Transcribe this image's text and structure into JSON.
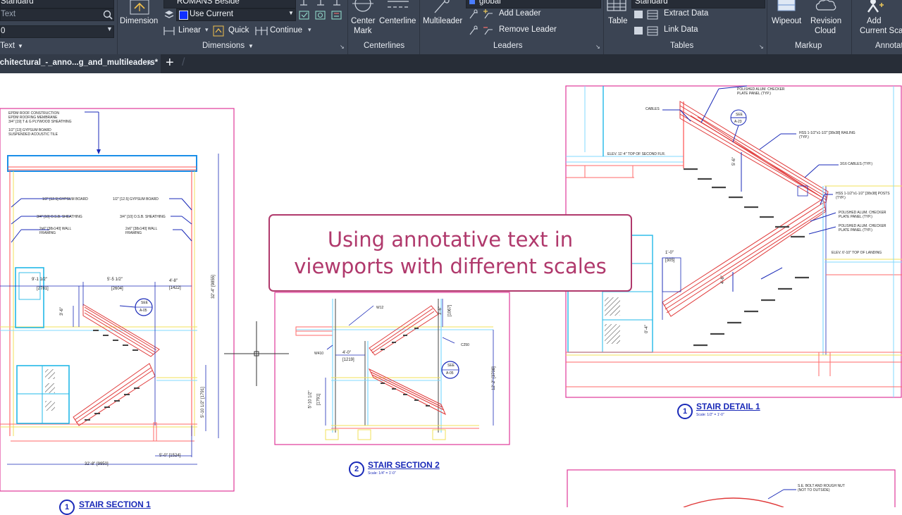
{
  "ribbon": {
    "text_panel": {
      "style_value": "Standard",
      "search_placeholder": "Text",
      "height_value": "0",
      "title": "Text"
    },
    "dimensions": {
      "dimension_label": "Dimension",
      "style_value": "ROMANS Beside",
      "layer_value": "Use Current",
      "linear_label": "Linear",
      "quick_label": "Quick",
      "continue_label": "Continue",
      "title": "Dimensions"
    },
    "centerlines": {
      "center_mark_label_1": "Center",
      "center_mark_label_2": "Mark",
      "centerline_label": "Centerline",
      "title": "Centerlines"
    },
    "leaders": {
      "multileader_label": "Multileader",
      "style_value": "global",
      "add_leader_label": "Add Leader",
      "remove_leader_label": "Remove Leader",
      "title": "Leaders"
    },
    "tables": {
      "table_label": "Table",
      "style_value": "Standard",
      "extract_data_label": "Extract Data",
      "link_data_label": "Link Data",
      "title": "Tables"
    },
    "markup": {
      "wipeout_label": "Wipeout",
      "revision_label_1": "Revision",
      "revision_label_2": "Cloud",
      "title": "Markup"
    },
    "annotation_scaling": {
      "add_label_1": "Add",
      "add_label_2": "Current Scale",
      "title": "Annotation Scaling"
    }
  },
  "document_tab": {
    "filename": "Architectural_-_anno...g_and_multileaders*",
    "close_symbol": "×",
    "new_tab_symbol": "+"
  },
  "callout": {
    "line1": "Using annotative text in",
    "line2": "viewports with different scales"
  },
  "viewports": [
    {
      "number": "1",
      "title": "STAIR SECTION 1",
      "scale": ""
    },
    {
      "number": "2",
      "title": "STAIR SECTION 2",
      "scale": "Scale: 1/4\" = 1'-0\""
    },
    {
      "number": "1",
      "title": "STAIR DETAIL 1",
      "scale": "Scale: 1/2\" = 1'-0\""
    }
  ],
  "drawing_notes": {
    "section1": {
      "roof_1": "EPDM ROOF CONSTRUCTION",
      "roof_2": "EPDM ROOFING MEMBRANE",
      "roof_3": "3/4\" [19] T & G PLYWOOD SHEATHING",
      "roof_4": "1/2\" [13] GYPSUM BOARD",
      "roof_5": "SUSPENDED ACOUSTIC TILE",
      "gyp_left": "1/2\" [12.5] GYPSUM BOARD",
      "gyp_right": "1/2\" [12.5] GYPSUM BOARD",
      "osb_left": "3/4\" [10] O.S.B. SHEATHING",
      "osb_right": "3/4\" [10] O.S.B. SHEATHING",
      "framing_left_1": "2x6\" [38x140] WALL",
      "framing_left_2": "FRAMING",
      "framing_right_1": "2x6\" [38x140] WALL",
      "framing_right_2": "FRAMING",
      "dim_a": "9'-1 1/2\"",
      "dim_a_mm": "[2781]",
      "dim_b": "5'-5 1/2\"",
      "dim_b_mm": "[2604]",
      "dim_c": "4'-8\"",
      "dim_c_mm": "[1422]",
      "dim_d": "3'-6\"",
      "dim_d_mm": "[1067]",
      "dim_e": "32'-4\" [9855]",
      "dim_f": "5'-10 1/2\" [1791]",
      "dim_g": "5'-0\" [1524]",
      "dim_h": "32'-8\" [9950]",
      "tag_top": "SEE",
      "tag_bottom": "A-05"
    },
    "section2": {
      "tag_top": "SEE",
      "tag_bottom": "A-05",
      "dim_a": "4'-0\"",
      "dim_a_mm": "[1219]",
      "dim_b": "5'-10 1/2\"",
      "dim_b_mm": "[1791]",
      "dim_c": "3'-6\"",
      "dim_c_mm": "[1067]",
      "dim_d": "12'-2\" [3708]",
      "note_1": "W12",
      "note_2": "W410",
      "note_3": "C250"
    },
    "detail1": {
      "checker": "POLISHED ALUM. CHECKER PLATE PANEL (TYP.)",
      "cables": "CABLES",
      "tag_top": "SEE",
      "tag_bottom": "A-23",
      "rail": "HSS 1-1/2\"x1-1/2\" [38x38] RAILING (TYP.)",
      "elev_1": "ELEV. 11'-4\" TOP OF SECOND FLR.",
      "cables_2": "3/16 CABLES (TYP.)",
      "posts": "HSS 1-1/2\"x1-1/2\" [38x38] POSTS (TYP.)",
      "checker_2": "POLISHED ALUM. CHECKER PLATE PANEL (TYP.)",
      "checker_3": "POLISHED ALUM. CHECKER PLATE PANEL (TYP.)",
      "elev_2": "ELEV. 6'-10\" TOP OF LANDING",
      "dim_a": "1'-0\"",
      "dim_a_mm": "[305]",
      "dim_b": "5'-6\"",
      "dim_c": "4'-6\"",
      "dim_d": "0'-4\""
    },
    "bottom_right": {
      "note_1": "S.E. BOLT AND ROUGH NUT",
      "note_2": "(NOT TO OUTSIDE)"
    }
  }
}
